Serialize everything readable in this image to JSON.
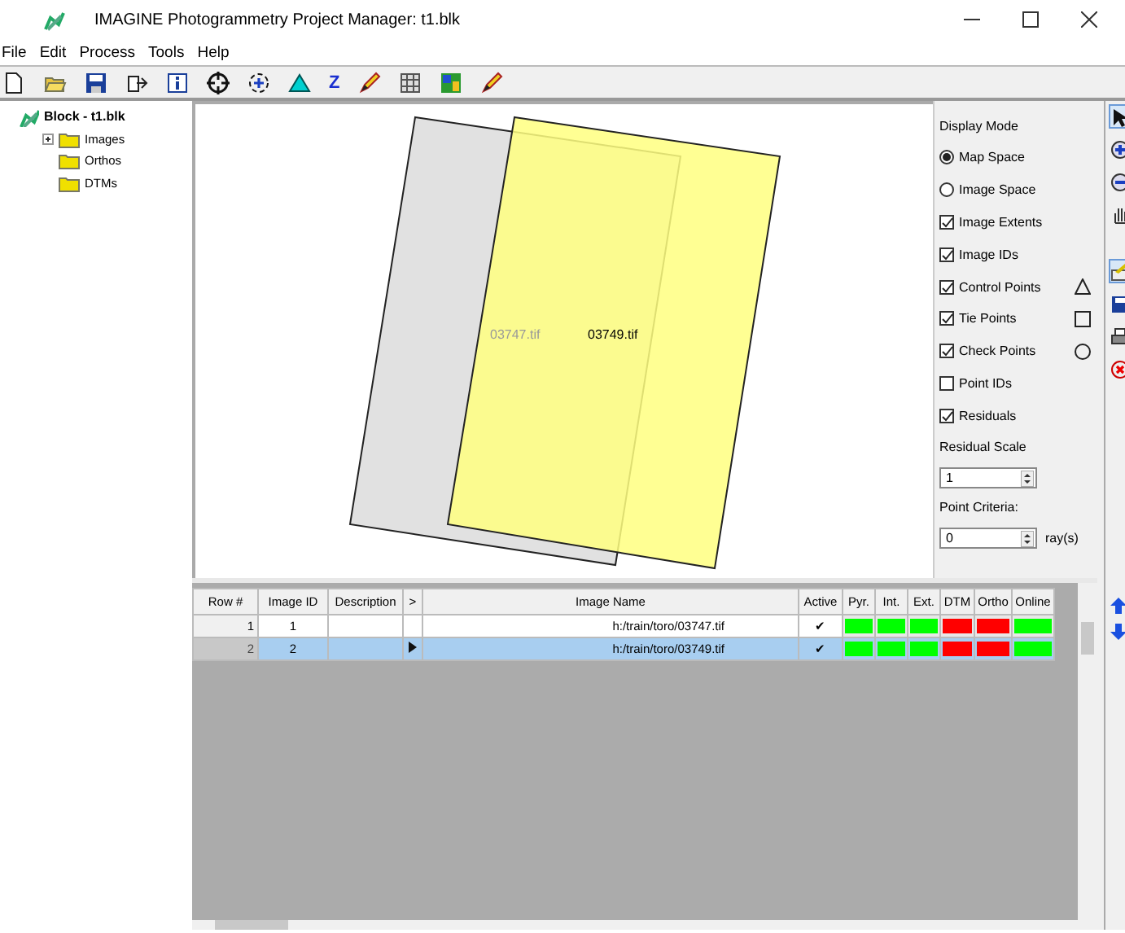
{
  "window": {
    "title": "IMAGINE Photogrammetry Project Manager: t1.blk"
  },
  "menu": [
    "File",
    "Edit",
    "Process",
    "Tools",
    "Help"
  ],
  "toolbar": [
    {
      "kind": "new"
    },
    {
      "kind": "open"
    },
    {
      "kind": "save"
    },
    {
      "kind": "export"
    },
    {
      "kind": "info"
    },
    {
      "kind": "target"
    },
    {
      "kind": "zoom"
    },
    {
      "kind": "triangle"
    },
    {
      "kind": "letter",
      "text": "Z"
    },
    {
      "kind": "pencil"
    },
    {
      "kind": "grid"
    },
    {
      "kind": "picture"
    },
    {
      "kind": "pencil"
    }
  ],
  "tree": {
    "label": "Block - t1.blk",
    "children": [
      {
        "label": "Images",
        "kind": "collapsed"
      },
      {
        "label": "Orthos",
        "kind": "leaf"
      },
      {
        "label": "DTMs",
        "kind": "leaf"
      }
    ]
  },
  "footprints": [
    {
      "label": "03747.tif",
      "color": "#dcdcdc"
    },
    {
      "label": "03749.tif",
      "color": "#ffff80"
    }
  ],
  "display_options": {
    "title": "Display Mode",
    "modes": [
      {
        "label": "Map Space",
        "selected": true
      },
      {
        "label": "Image Space",
        "selected": false
      }
    ],
    "layers": [
      {
        "label": "Image Extents",
        "checked": true
      },
      {
        "label": "Image IDs",
        "checked": true
      },
      {
        "label": "Control Points",
        "checked": true,
        "kind": "triangle"
      },
      {
        "label": "Tie Points",
        "checked": true,
        "kind": "square"
      },
      {
        "label": "Check Points",
        "checked": true,
        "kind": "circle"
      },
      {
        "label": "Point IDs",
        "checked": false
      },
      {
        "label": "Residuals",
        "checked": true
      }
    ],
    "residual_scale": {
      "label": "Residual Scale",
      "value": "1"
    },
    "point_criteria": {
      "label": "Point Criteria:",
      "value": "0",
      "unit": "ray(s)"
    }
  },
  "side_tools": [
    {
      "kind": "pointer",
      "selected": true
    },
    {
      "kind": "zoom-in",
      "selected": false
    },
    {
      "kind": "zoom-out",
      "selected": false
    },
    {
      "kind": "hand",
      "selected": false
    },
    {
      "kind": "gap"
    },
    {
      "kind": "edit",
      "selected": true
    },
    {
      "kind": "save",
      "selected": false
    },
    {
      "kind": "print",
      "selected": false
    },
    {
      "kind": "close",
      "selected": false
    }
  ],
  "table": {
    "columns": [
      "Row #",
      "Image ID",
      "Description",
      ">",
      "Image Name",
      "Active",
      "Pyr.",
      "Int.",
      "Ext.",
      "DTM",
      "Ortho",
      "Online"
    ],
    "rows": [
      {
        "row": "1",
        "image_id": "1",
        "current": false,
        "image_name": "h:/train/toro/03747.tif",
        "active": "✔",
        "selected": false,
        "status": [
          {
            "color": "#00ff00"
          },
          {
            "color": "#00ff00"
          },
          {
            "color": "#00ff00"
          },
          {
            "color": "#ff0000"
          },
          {
            "color": "#ff0000"
          },
          {
            "color": "#00ff00"
          }
        ]
      },
      {
        "row": "2",
        "image_id": "2",
        "current": true,
        "image_name": "h:/train/toro/03749.tif",
        "active": "✔",
        "selected": true,
        "status": [
          {
            "color": "#00ff00"
          },
          {
            "color": "#00ff00"
          },
          {
            "color": "#00ff00"
          },
          {
            "color": "#ff0000"
          },
          {
            "color": "#ff0000"
          },
          {
            "color": "#00ff00"
          }
        ]
      }
    ]
  }
}
